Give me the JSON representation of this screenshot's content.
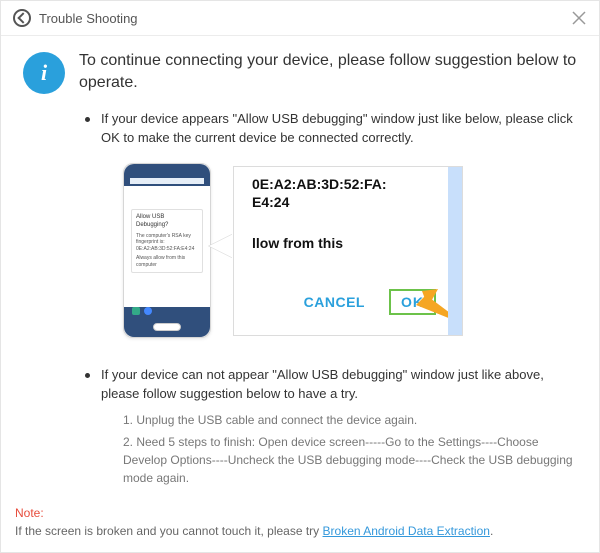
{
  "window": {
    "title": "Trouble Shooting"
  },
  "info_glyph": "i",
  "hero": "To continue connecting your device, please follow suggestion below to operate.",
  "items": [
    {
      "text": "If your device appears \"Allow USB debugging\" window just like below, please click OK to make the current device  be connected correctly."
    },
    {
      "text": "If your device can not appear \"Allow USB debugging\" window just like above, please follow suggestion below to have a try.",
      "steps": [
        "1. Unplug the USB cable and connect the device again.",
        "2. Need 5 steps to finish: Open device screen-----Go to the Settings----Choose Develop Options----Uncheck the USB debugging mode----Check the USB debugging mode again."
      ]
    }
  ],
  "phone_dialog": {
    "title": "Allow USB Debugging?",
    "body1": "The computer's RSA key fingerprint is:",
    "body2": "0E:A2:AB:3D:52:FA:E4:24",
    "check": "Always allow from this computer"
  },
  "zoom": {
    "line1": "0E:A2:AB:3D:52:FA:",
    "line2": "E4:24",
    "allow": "llow from this",
    "cancel": "CANCEL",
    "ok": "OK"
  },
  "footer": {
    "note_label": "Note:",
    "note_text": "If the screen is broken and you cannot touch it, please try ",
    "link": "Broken Android Data Extraction",
    "suffix": "."
  }
}
